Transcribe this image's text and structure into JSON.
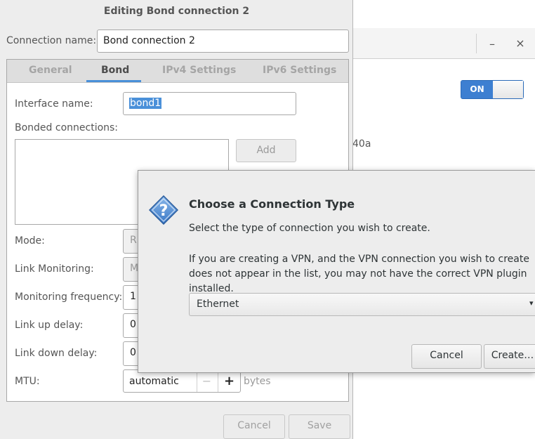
{
  "background_window": {
    "switch_label": "ON",
    "text_fragment": "40a",
    "minimize_glyph": "–",
    "close_glyph": "×"
  },
  "edit_dialog": {
    "title": "Editing Bond connection 2",
    "connection_name_label": "Connection name:",
    "connection_name_value": "Bond connection 2",
    "tabs": [
      "General",
      "Bond",
      "IPv4 Settings",
      "IPv6 Settings"
    ],
    "active_tab": "Bond",
    "interface_name_label": "Interface name:",
    "interface_name_value": "bond1",
    "bonded_connections_label": "Bonded connections:",
    "add_button": "Add",
    "mode_label": "Mode:",
    "mode_value": "R",
    "link_monitoring_label": "Link Monitoring:",
    "link_monitoring_value": "M",
    "monitoring_frequency_label": "Monitoring frequency:",
    "monitoring_frequency_value": "1",
    "link_up_delay_label": "Link up delay:",
    "link_up_delay_value": "0",
    "link_down_delay_label": "Link down delay:",
    "link_down_delay_value": "0",
    "mtu_label": "MTU:",
    "mtu_value": "automatic",
    "mtu_minus": "−",
    "mtu_plus": "+",
    "mtu_unit": "bytes",
    "cancel_button": "Cancel",
    "save_button": "Save"
  },
  "choose_dialog": {
    "title": "Choose a Connection Type",
    "description": "Select the type of connection you wish to create.",
    "vpn_note": "If you are creating a VPN, and the VPN connection you wish to create does not appear in the list, you may not have the correct VPN plugin installed.",
    "selected_type": "Ethernet",
    "cancel_button": "Cancel",
    "create_button": "Create…",
    "icon": "question-icon",
    "accent_color": "#4a90d9"
  }
}
